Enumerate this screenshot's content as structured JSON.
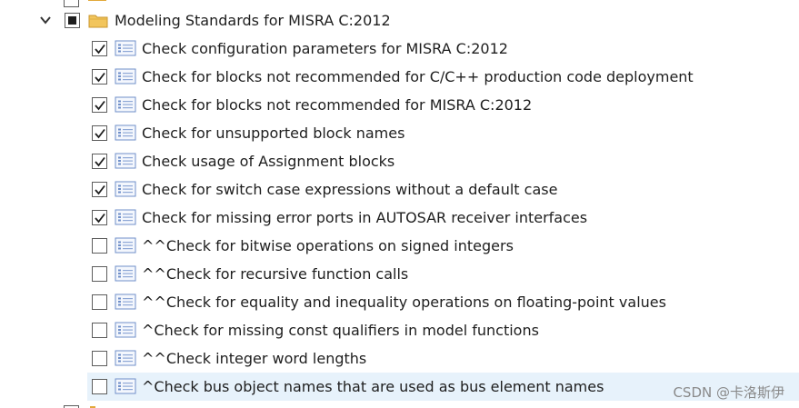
{
  "tree": {
    "parent": {
      "label": "Modeling Standards for MISRA C:2012",
      "state": "partial",
      "expanded": true
    },
    "items": [
      {
        "label": "Check configuration parameters for MISRA C:2012",
        "checked": true
      },
      {
        "label": "Check for blocks not recommended for C/C++ production code deployment",
        "checked": true
      },
      {
        "label": "Check for blocks not recommended for MISRA C:2012",
        "checked": true
      },
      {
        "label": "Check for unsupported block names",
        "checked": true
      },
      {
        "label": "Check usage of Assignment blocks",
        "checked": true
      },
      {
        "label": "Check for switch case expressions without a default case",
        "checked": true
      },
      {
        "label": "Check for missing error ports in AUTOSAR receiver interfaces",
        "checked": true
      },
      {
        "label": "^^Check for bitwise operations on signed integers",
        "checked": false
      },
      {
        "label": "^^Check for recursive function calls",
        "checked": false
      },
      {
        "label": "^^Check for equality and inequality operations on floating-point values",
        "checked": false
      },
      {
        "label": "^Check for missing const qualifiers in model functions",
        "checked": false
      },
      {
        "label": "^^Check integer word lengths",
        "checked": false
      },
      {
        "label": "^Check bus object names that are used as bus element names",
        "checked": false,
        "selected": true
      }
    ]
  },
  "watermark": "CSDN @卡洛斯伊",
  "colors": {
    "selection": "#e7f2fb",
    "folder": "#f2c55c",
    "doc_icon": "#6f8fc9"
  },
  "icons": {
    "expander": "chevron-down-icon",
    "parent_icon": "folder-icon",
    "item_icon": "check-document-icon",
    "check_mark": "checkmark-icon"
  }
}
